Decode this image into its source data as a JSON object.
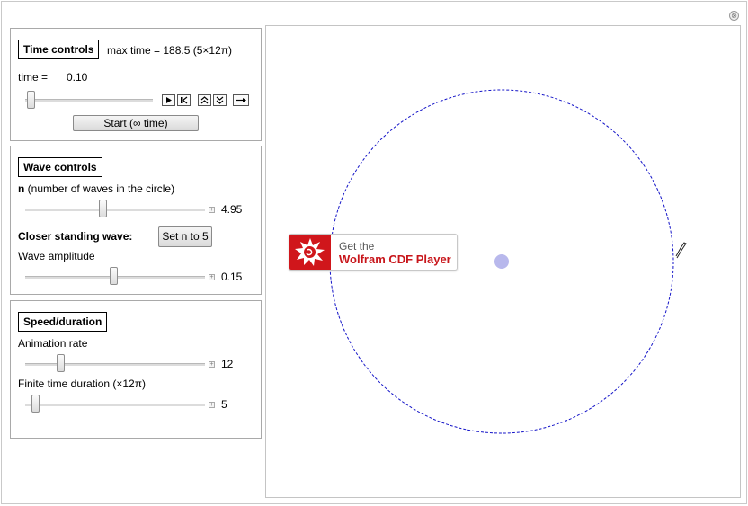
{
  "time_controls": {
    "title": "Time controls",
    "max_time": "max time = 188.5 (5×12π)",
    "time_label": "time =",
    "time_value": "0.10",
    "time_slider_level": 0.0005,
    "start_button": "Start (∞ time)",
    "anim_buttons": [
      "play-icon",
      "step-back-icon",
      "faster-icon",
      "slower-icon",
      "direction-icon"
    ]
  },
  "wave_controls": {
    "title": "Wave controls",
    "n_label_bold": "n",
    "n_label_rest": " (number of waves in the circle)",
    "n_value": "4.95",
    "closer_label": "Closer standing wave:",
    "set_button": "Set n to  5",
    "amplitude_label": "Wave amplitude",
    "amplitude_value": "0.15"
  },
  "speed_duration": {
    "title": "Speed/duration",
    "rate_label": "Animation rate",
    "rate_value": "12",
    "duration_label": "Finite time duration (×12π)",
    "duration_value": "5"
  },
  "cdf_banner": {
    "line1": "Get the",
    "line2": "Wolfram CDF Player"
  },
  "colors": {
    "circle": "#1515c8",
    "dot": "#b8b8ec",
    "cdf_red": "#d0161b"
  }
}
